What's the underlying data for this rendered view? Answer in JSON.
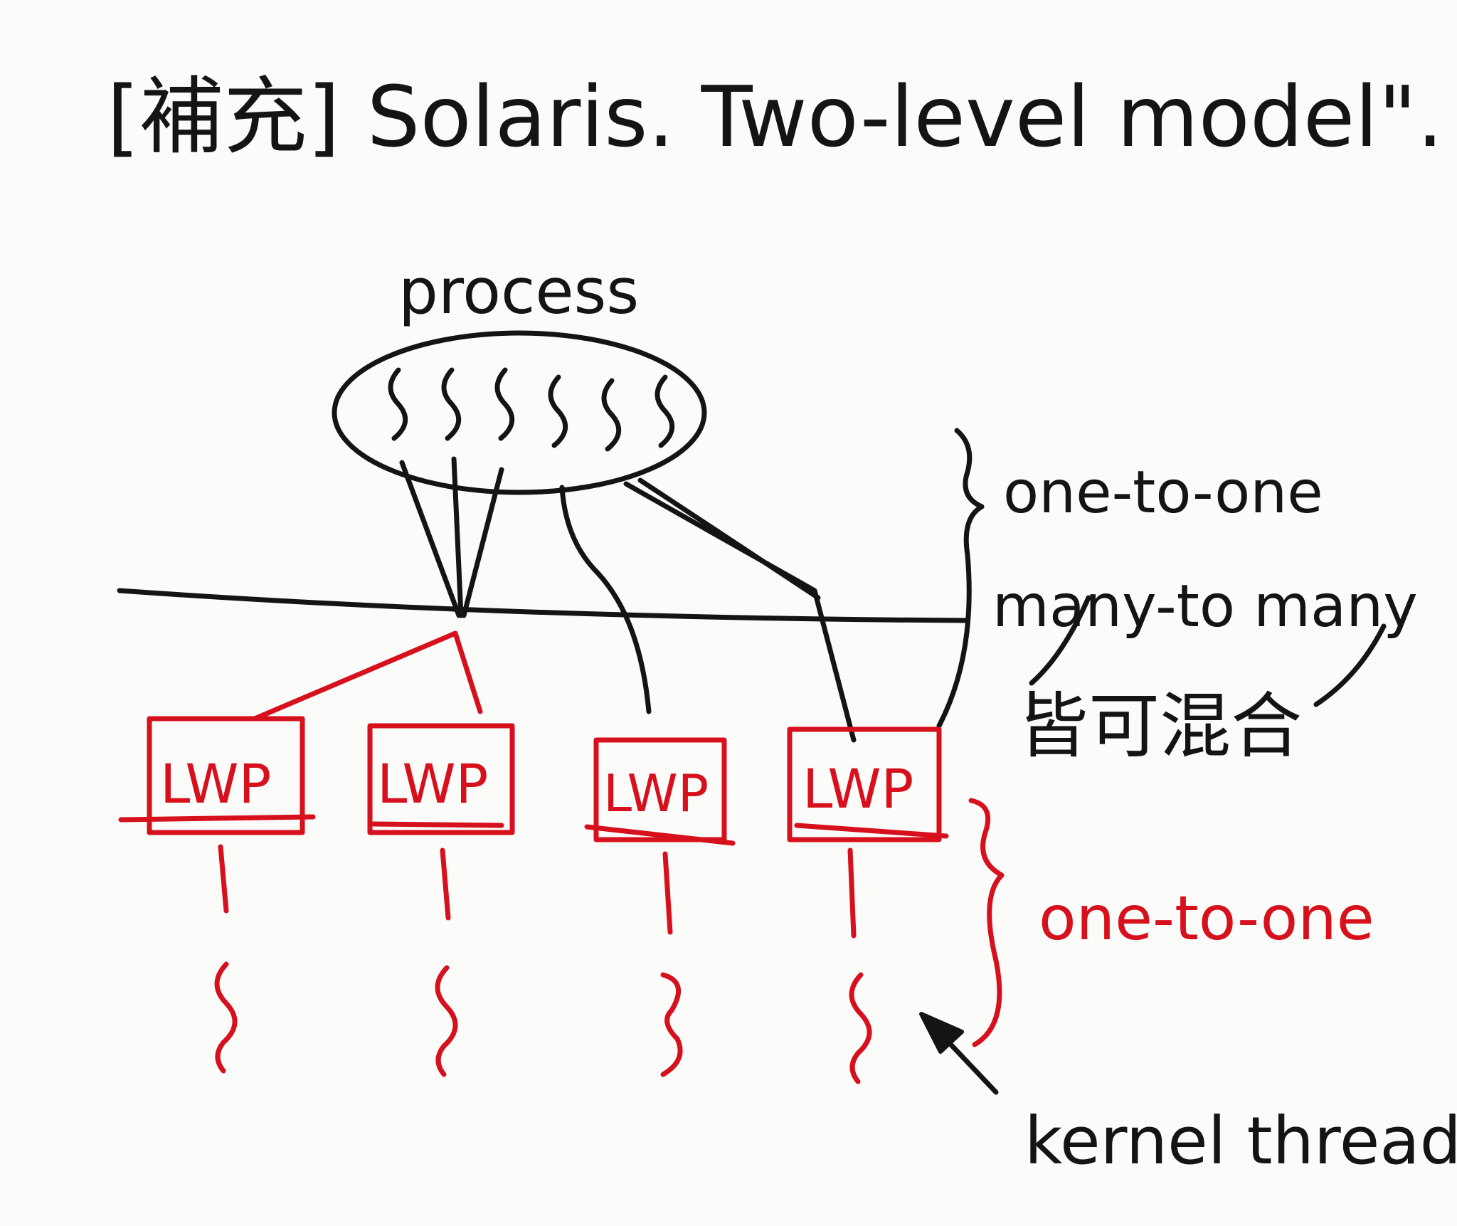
{
  "title": "[補充] Solaris. Two-level model\".",
  "process_label": "process",
  "upper_labels": {
    "line1": "one-to-one",
    "line2": "many-to many",
    "line3": "皆可混合"
  },
  "lwp_labels": [
    "LWP",
    "LWP",
    "LWP",
    "LWP"
  ],
  "lower_label": "one-to-one",
  "kernel_label": "kernel thread.",
  "colors": {
    "ink": "#141414",
    "red": "#d6101c",
    "paper": "#fbfbf9"
  }
}
